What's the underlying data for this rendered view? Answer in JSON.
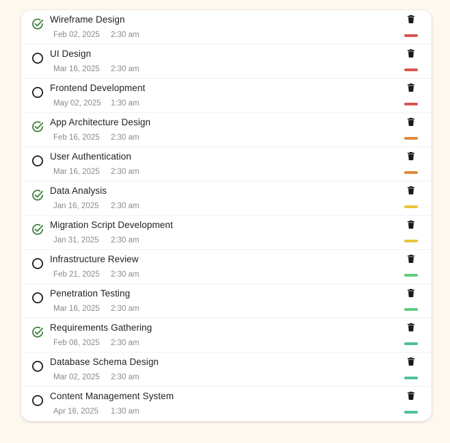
{
  "colors": {
    "background": "#fdf9f1",
    "check": "#3f7f3a",
    "high": "#d9534f",
    "medium": "#e08a36",
    "normal": "#e6c63a",
    "low": "#5ccf7f",
    "lowest": "#4dbf9a"
  },
  "icons": {
    "done": "check-circle-icon",
    "pending": "empty-circle-icon",
    "delete": "trash-icon"
  },
  "tasks": [
    {
      "title": "Wireframe Design",
      "date": "Feb 02, 2025",
      "time": "2:30 am",
      "done": true,
      "priority_color": "#d9534f"
    },
    {
      "title": "UI Design",
      "date": "Mar 16, 2025",
      "time": "2:30 am",
      "done": false,
      "priority_color": "#d9534f"
    },
    {
      "title": "Frontend Development",
      "date": "May 02, 2025",
      "time": "1:30 am",
      "done": false,
      "priority_color": "#d9534f"
    },
    {
      "title": "App Architecture Design",
      "date": "Feb 16, 2025",
      "time": "2:30 am",
      "done": true,
      "priority_color": "#e08a36"
    },
    {
      "title": "User Authentication",
      "date": "Mar 16, 2025",
      "time": "2:30 am",
      "done": false,
      "priority_color": "#e08a36"
    },
    {
      "title": "Data Analysis",
      "date": "Jan 16, 2025",
      "time": "2:30 am",
      "done": true,
      "priority_color": "#e6c63a"
    },
    {
      "title": "Migration Script Development",
      "date": "Jan 31, 2025",
      "time": "2:30 am",
      "done": true,
      "priority_color": "#e6c63a"
    },
    {
      "title": "Infrastructure Review",
      "date": "Feb 21, 2025",
      "time": "2:30 am",
      "done": false,
      "priority_color": "#5ccf7f"
    },
    {
      "title": "Penetration Testing",
      "date": "Mar 16, 2025",
      "time": "2:30 am",
      "done": false,
      "priority_color": "#5ccf7f"
    },
    {
      "title": "Requirements Gathering",
      "date": "Feb 08, 2025",
      "time": "2:30 am",
      "done": true,
      "priority_color": "#4dbf9a"
    },
    {
      "title": "Database Schema Design",
      "date": "Mar 02, 2025",
      "time": "2:30 am",
      "done": false,
      "priority_color": "#4dbf9a"
    },
    {
      "title": "Content Management System",
      "date": "Apr 16, 2025",
      "time": "1:30 am",
      "done": false,
      "priority_color": "#4dbf9a"
    }
  ]
}
